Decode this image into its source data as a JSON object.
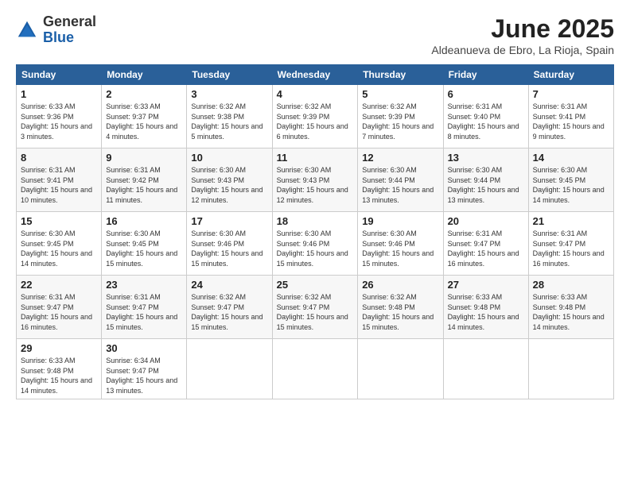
{
  "logo": {
    "general": "General",
    "blue": "Blue"
  },
  "header": {
    "month_year": "June 2025",
    "location": "Aldeanueva de Ebro, La Rioja, Spain"
  },
  "weekdays": [
    "Sunday",
    "Monday",
    "Tuesday",
    "Wednesday",
    "Thursday",
    "Friday",
    "Saturday"
  ],
  "weeks": [
    [
      {
        "day": "1",
        "sunrise": "6:33 AM",
        "sunset": "9:36 PM",
        "daylight": "15 hours and 3 minutes."
      },
      {
        "day": "2",
        "sunrise": "6:33 AM",
        "sunset": "9:37 PM",
        "daylight": "15 hours and 4 minutes."
      },
      {
        "day": "3",
        "sunrise": "6:32 AM",
        "sunset": "9:38 PM",
        "daylight": "15 hours and 5 minutes."
      },
      {
        "day": "4",
        "sunrise": "6:32 AM",
        "sunset": "9:39 PM",
        "daylight": "15 hours and 6 minutes."
      },
      {
        "day": "5",
        "sunrise": "6:32 AM",
        "sunset": "9:39 PM",
        "daylight": "15 hours and 7 minutes."
      },
      {
        "day": "6",
        "sunrise": "6:31 AM",
        "sunset": "9:40 PM",
        "daylight": "15 hours and 8 minutes."
      },
      {
        "day": "7",
        "sunrise": "6:31 AM",
        "sunset": "9:41 PM",
        "daylight": "15 hours and 9 minutes."
      }
    ],
    [
      {
        "day": "8",
        "sunrise": "6:31 AM",
        "sunset": "9:41 PM",
        "daylight": "15 hours and 10 minutes."
      },
      {
        "day": "9",
        "sunrise": "6:31 AM",
        "sunset": "9:42 PM",
        "daylight": "15 hours and 11 minutes."
      },
      {
        "day": "10",
        "sunrise": "6:30 AM",
        "sunset": "9:43 PM",
        "daylight": "15 hours and 12 minutes."
      },
      {
        "day": "11",
        "sunrise": "6:30 AM",
        "sunset": "9:43 PM",
        "daylight": "15 hours and 12 minutes."
      },
      {
        "day": "12",
        "sunrise": "6:30 AM",
        "sunset": "9:44 PM",
        "daylight": "15 hours and 13 minutes."
      },
      {
        "day": "13",
        "sunrise": "6:30 AM",
        "sunset": "9:44 PM",
        "daylight": "15 hours and 13 minutes."
      },
      {
        "day": "14",
        "sunrise": "6:30 AM",
        "sunset": "9:45 PM",
        "daylight": "15 hours and 14 minutes."
      }
    ],
    [
      {
        "day": "15",
        "sunrise": "6:30 AM",
        "sunset": "9:45 PM",
        "daylight": "15 hours and 14 minutes."
      },
      {
        "day": "16",
        "sunrise": "6:30 AM",
        "sunset": "9:45 PM",
        "daylight": "15 hours and 15 minutes."
      },
      {
        "day": "17",
        "sunrise": "6:30 AM",
        "sunset": "9:46 PM",
        "daylight": "15 hours and 15 minutes."
      },
      {
        "day": "18",
        "sunrise": "6:30 AM",
        "sunset": "9:46 PM",
        "daylight": "15 hours and 15 minutes."
      },
      {
        "day": "19",
        "sunrise": "6:30 AM",
        "sunset": "9:46 PM",
        "daylight": "15 hours and 15 minutes."
      },
      {
        "day": "20",
        "sunrise": "6:31 AM",
        "sunset": "9:47 PM",
        "daylight": "15 hours and 16 minutes."
      },
      {
        "day": "21",
        "sunrise": "6:31 AM",
        "sunset": "9:47 PM",
        "daylight": "15 hours and 16 minutes."
      }
    ],
    [
      {
        "day": "22",
        "sunrise": "6:31 AM",
        "sunset": "9:47 PM",
        "daylight": "15 hours and 16 minutes."
      },
      {
        "day": "23",
        "sunrise": "6:31 AM",
        "sunset": "9:47 PM",
        "daylight": "15 hours and 15 minutes."
      },
      {
        "day": "24",
        "sunrise": "6:32 AM",
        "sunset": "9:47 PM",
        "daylight": "15 hours and 15 minutes."
      },
      {
        "day": "25",
        "sunrise": "6:32 AM",
        "sunset": "9:47 PM",
        "daylight": "15 hours and 15 minutes."
      },
      {
        "day": "26",
        "sunrise": "6:32 AM",
        "sunset": "9:48 PM",
        "daylight": "15 hours and 15 minutes."
      },
      {
        "day": "27",
        "sunrise": "6:33 AM",
        "sunset": "9:48 PM",
        "daylight": "15 hours and 14 minutes."
      },
      {
        "day": "28",
        "sunrise": "6:33 AM",
        "sunset": "9:48 PM",
        "daylight": "15 hours and 14 minutes."
      }
    ],
    [
      {
        "day": "29",
        "sunrise": "6:33 AM",
        "sunset": "9:48 PM",
        "daylight": "15 hours and 14 minutes."
      },
      {
        "day": "30",
        "sunrise": "6:34 AM",
        "sunset": "9:47 PM",
        "daylight": "15 hours and 13 minutes."
      },
      null,
      null,
      null,
      null,
      null
    ]
  ]
}
